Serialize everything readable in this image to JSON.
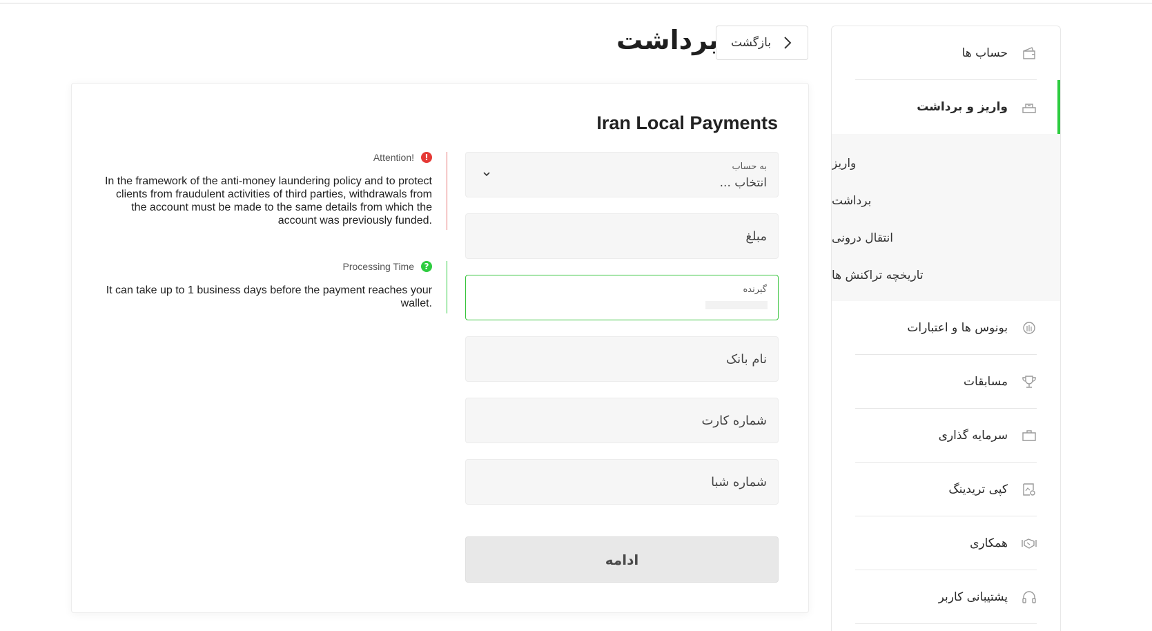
{
  "header": {
    "title": "برداشت",
    "back_label": "بازگشت"
  },
  "sidebar": {
    "items": [
      {
        "label": "حساب ها",
        "icon": "wallet-icon"
      },
      {
        "label": "واریز و برداشت",
        "icon": "deposit-withdraw-icon",
        "active": true
      },
      {
        "label": "بونوس ها و اعتبارات",
        "icon": "bonus-icon"
      },
      {
        "label": "مسابقات",
        "icon": "trophy-icon"
      },
      {
        "label": "سرمایه گذاری",
        "icon": "briefcase-icon"
      },
      {
        "label": "کپی تریدینگ",
        "icon": "copy-trading-icon"
      },
      {
        "label": "همکاری",
        "icon": "handshake-icon"
      },
      {
        "label": "پشتیبانی کاربر",
        "icon": "headset-icon"
      }
    ],
    "submenu": [
      "واریز",
      "برداشت",
      "انتقال درونی",
      "تاریخچه تراکنش ها"
    ]
  },
  "form": {
    "title": "Iran Local Payments",
    "account": {
      "label": "به حساب",
      "value": "انتخاب ..."
    },
    "amount_placeholder": "مبلغ",
    "recipient_label": "گیرنده",
    "bank_name_placeholder": "نام بانک",
    "card_number_placeholder": "شماره کارت",
    "sheba_placeholder": "شماره شبا",
    "submit_label": "ادامه"
  },
  "info": {
    "attention": {
      "title": "Attention!",
      "body": "In the framework of the anti-money laundering policy and to protect clients from fraudulent activities of third parties, withdrawals from the account must be made to the same details from which the account was previously funded.",
      "color": "#e53935"
    },
    "processing": {
      "title": "Processing Time",
      "body": "It can take up to 1 business days before the payment reaches your wallet.",
      "color": "#2ecc40"
    }
  },
  "colors": {
    "accent": "#2ecc40",
    "danger": "#e53935"
  }
}
